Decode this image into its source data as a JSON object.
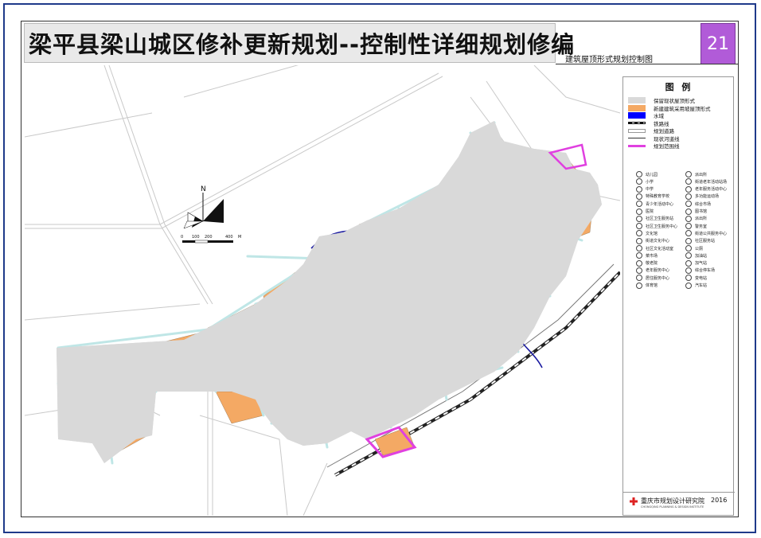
{
  "title": "梁平县梁山城区修补更新规划--控制性详细规划修编",
  "subtitle": "建筑屋顶形式规划控制图",
  "sheet_number": "21",
  "legend": {
    "title": "图 例",
    "items": [
      {
        "label": "保留现状屋顶形式",
        "color": "#d9d9d9",
        "kind": "fill"
      },
      {
        "label": "新建建筑采用坡屋顶形式",
        "color": "#f4a964",
        "kind": "fill"
      },
      {
        "label": "水域",
        "color": "#0000ff",
        "kind": "fill"
      },
      {
        "label": "铁路线",
        "color": "#111111",
        "kind": "rail"
      },
      {
        "label": "规划道路",
        "color": "#999999",
        "kind": "road"
      },
      {
        "label": "现状河道线",
        "color": "#333333",
        "kind": "line"
      },
      {
        "label": "规划范围线",
        "color": "#e040e0",
        "kind": "boundary"
      }
    ],
    "symbols_left": [
      "幼儿园",
      "小学",
      "中学",
      "特殊教育学校",
      "青少年活动中心",
      "医院",
      "社区卫生服务站",
      "社区卫生服务中心",
      "文化馆",
      "街道文化中心",
      "社区文化活动室",
      "菜市场",
      "敬老院",
      "老年服务中心",
      "居住服务中心",
      "体育馆"
    ],
    "symbols_right": [
      "派出所",
      "街道老年活动站场",
      "老年服务活动中心",
      "多功能运动场",
      "综合市场",
      "图书馆",
      "派出所",
      "警务室",
      "街道公共服务中心",
      "社区服务站",
      "公厕",
      "加油站",
      "加气站",
      "综合停车场",
      "变电站",
      "汽车站"
    ]
  },
  "scale": {
    "ticks": [
      "0",
      "100",
      "200",
      "400"
    ],
    "unit": "M"
  },
  "north_label": "N",
  "institute": "重庆市规划设计研究院",
  "institute_en": "CHONGQING PLANNING & DESIGN INSTITUTE",
  "year": "2016",
  "colors": {
    "existing": "#d9d9d9",
    "new_pitched": "#f4a964",
    "road": "#bfe6e6",
    "boundary": "#e040e0",
    "water": "#1a1aa0",
    "title_accent": "#b15bd8"
  }
}
